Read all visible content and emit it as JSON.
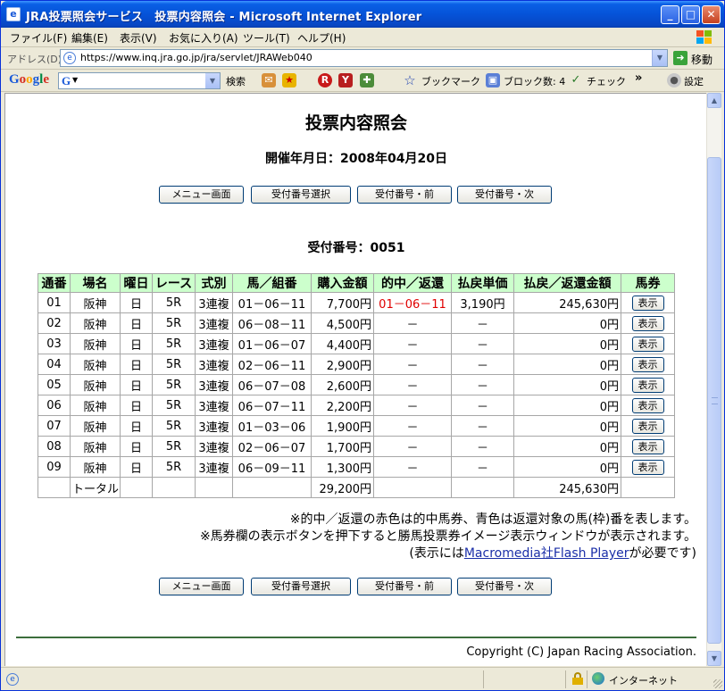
{
  "window": {
    "title": "JRA投票照会サービス　投票内容照会 - Microsoft Internet Explorer",
    "title_icon": "ie-page-icon"
  },
  "menu": {
    "items": [
      "ファイル(F)",
      "編集(E)",
      "表示(V)",
      "お気に入り(A)",
      "ツール(T)",
      "ヘルプ(H)"
    ]
  },
  "address": {
    "label": "アドレス(D)",
    "url": "https://www.inq.jra.go.jp/jra/servlet/JRAWeb040",
    "go_label": "移動"
  },
  "google_toolbar": {
    "logo": "Google",
    "box_letter": "G",
    "search_label": "検索",
    "bookmark_label": "ブックマーク",
    "block_label": "ブロック数: 4",
    "check_label": "チェック",
    "more": "»",
    "settings_label": "設定"
  },
  "page": {
    "title": "投票内容照会",
    "date_line": "開催年月日：2008年04月20日",
    "buttons": [
      "メニュー画面",
      "受付番号選択",
      "受付番号・前",
      "受付番号・次"
    ],
    "receipt_line": "受付番号：0051",
    "table": {
      "headers": [
        "通番",
        "場名",
        "曜日",
        "レース",
        "式別",
        "馬／組番",
        "購入金額",
        "的中／返還",
        "払戻単価",
        "払戻／返還金額",
        "馬券"
      ],
      "rows": [
        [
          "01",
          "阪神",
          "日",
          "5R",
          "3連複",
          "01－06－11",
          "7,700円",
          "01－06－11",
          "3,190円",
          "245,630円",
          "表示"
        ],
        [
          "02",
          "阪神",
          "日",
          "5R",
          "3連複",
          "06－08－11",
          "4,500円",
          "－",
          "－",
          "0円",
          "表示"
        ],
        [
          "03",
          "阪神",
          "日",
          "5R",
          "3連複",
          "01－06－07",
          "4,400円",
          "－",
          "－",
          "0円",
          "表示"
        ],
        [
          "04",
          "阪神",
          "日",
          "5R",
          "3連複",
          "02－06－11",
          "2,900円",
          "－",
          "－",
          "0円",
          "表示"
        ],
        [
          "05",
          "阪神",
          "日",
          "5R",
          "3連複",
          "06－07－08",
          "2,600円",
          "－",
          "－",
          "0円",
          "表示"
        ],
        [
          "06",
          "阪神",
          "日",
          "5R",
          "3連複",
          "06－07－11",
          "2,200円",
          "－",
          "－",
          "0円",
          "表示"
        ],
        [
          "07",
          "阪神",
          "日",
          "5R",
          "3連複",
          "01－03－06",
          "1,900円",
          "－",
          "－",
          "0円",
          "表示"
        ],
        [
          "08",
          "阪神",
          "日",
          "5R",
          "3連複",
          "02－06－07",
          "1,700円",
          "－",
          "－",
          "0円",
          "表示"
        ],
        [
          "09",
          "阪神",
          "日",
          "5R",
          "3連複",
          "06－09－11",
          "1,300円",
          "－",
          "－",
          "0円",
          "表示"
        ]
      ],
      "total": {
        "label": "トータル",
        "purchase": "29,200円",
        "payout": "245,630円"
      }
    },
    "notes": {
      "line1": "※的中／返還の赤色は的中馬券、青色は返還対象の馬(枠)番を表します。",
      "line2": "※馬券欄の表示ボタンを押下すると勝馬投票券イメージ表示ウィンドウが表示されます。",
      "line3_prefix": "(表示には",
      "line3_link": "Macromedia社Flash Player",
      "line3_suffix": "が必要です)"
    },
    "copyright": "Copyright (C) Japan Racing Association."
  },
  "statusbar": {
    "zone": "インターネット"
  },
  "colors": {
    "hit": "#e00000",
    "header_bg": "#ccffcc",
    "title_bar": "#0553d8"
  }
}
